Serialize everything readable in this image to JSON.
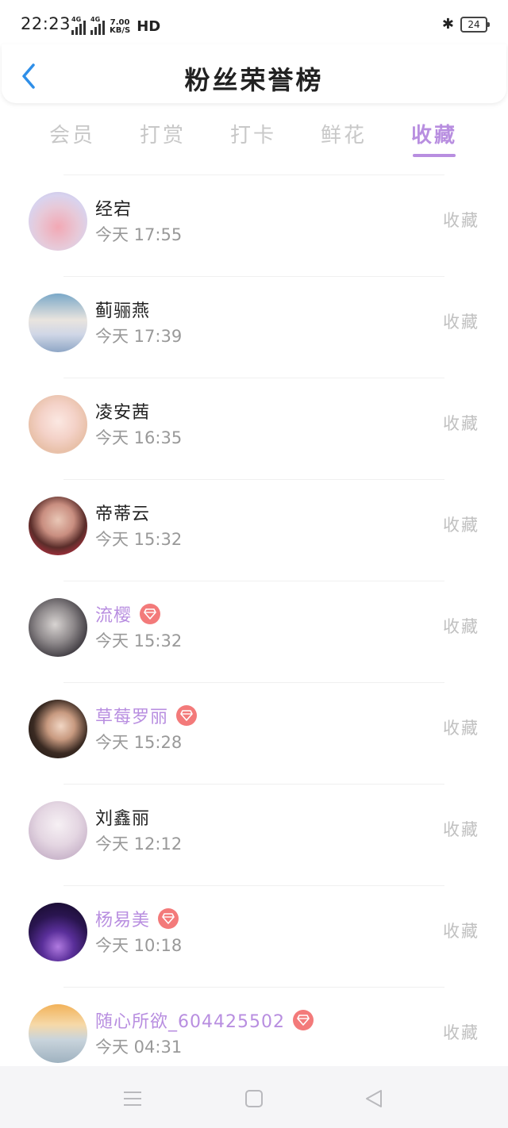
{
  "status": {
    "time": "22:23",
    "net1": "4G",
    "net2": "4G",
    "speed_value": "7.00",
    "speed_unit": "KB/S",
    "hd": "HD",
    "battery": "24"
  },
  "header": {
    "title": "粉丝荣誉榜"
  },
  "tabs": [
    {
      "label": "会员",
      "active": false
    },
    {
      "label": "打赏",
      "active": false
    },
    {
      "label": "打卡",
      "active": false
    },
    {
      "label": "鲜花",
      "active": false
    },
    {
      "label": "收藏",
      "active": true
    }
  ],
  "colors": {
    "accent": "#b88ee0",
    "vip_badge": "#f37a7a"
  },
  "fans": [
    {
      "name": "经宕",
      "time": "今天 17:55",
      "vip": false,
      "action": "收藏"
    },
    {
      "name": "蓟骊燕",
      "time": "今天 17:39",
      "vip": false,
      "action": "收藏"
    },
    {
      "name": "凌安茜",
      "time": "今天 16:35",
      "vip": false,
      "action": "收藏"
    },
    {
      "name": "帝蒂云",
      "time": "今天 15:32",
      "vip": false,
      "action": "收藏"
    },
    {
      "name": "流樱",
      "time": "今天 15:32",
      "vip": true,
      "action": "收藏"
    },
    {
      "name": "草莓罗丽",
      "time": "今天 15:28",
      "vip": true,
      "action": "收藏"
    },
    {
      "name": "刘鑫丽",
      "time": "今天 12:12",
      "vip": false,
      "action": "收藏"
    },
    {
      "name": "杨易美",
      "time": "今天 10:18",
      "vip": true,
      "action": "收藏"
    },
    {
      "name": "随心所欲_604425502",
      "time": "今天 04:31",
      "vip": true,
      "action": "收藏"
    }
  ],
  "icons": {
    "back": "chevron-left-icon",
    "vip": "diamond-icon",
    "menu": "menu-icon",
    "home": "square-icon",
    "back_nav": "triangle-back-icon"
  }
}
